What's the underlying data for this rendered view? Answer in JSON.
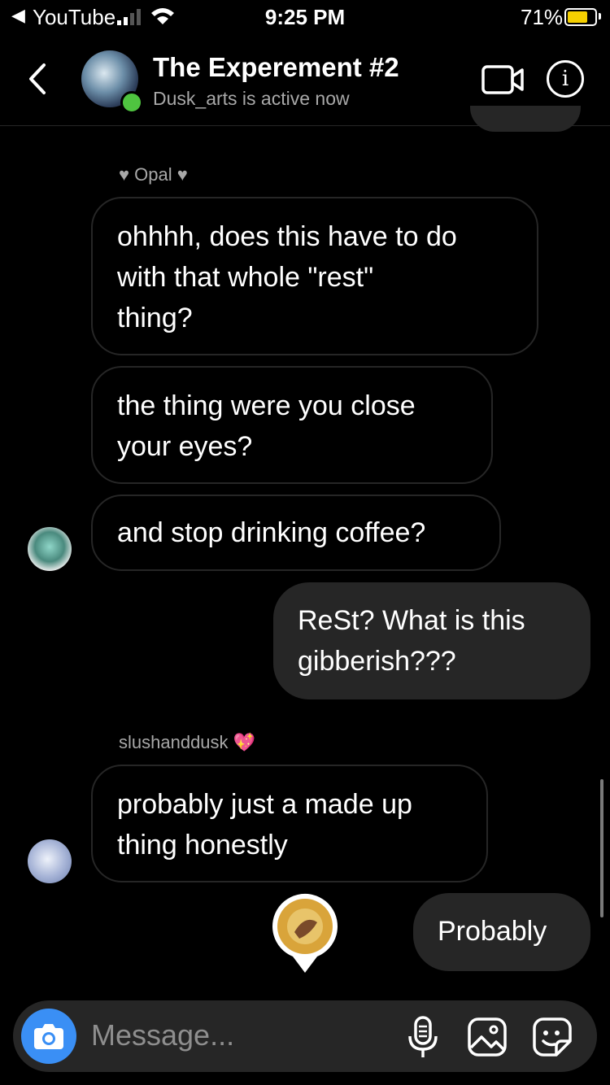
{
  "status_bar": {
    "back_app": "YouTube",
    "time": "9:25 PM",
    "battery_pct": "71%",
    "back_glyph": "◀"
  },
  "header": {
    "title": "The Experement #2",
    "subtitle": "Dusk_arts is active now",
    "info_glyph": "i"
  },
  "messages": {
    "opal_sender": "♥ Opal ♥",
    "m1": [
      "ohhhh, does this have to do",
      "with that whole \"rest\"",
      "thing?"
    ],
    "m2": [
      "the thing were you close",
      "your eyes?"
    ],
    "m3": "and stop drinking coffee?",
    "m4": [
      "ReSt? What is this",
      "gibberish???"
    ],
    "slush_sender": "slushanddusk",
    "slush_emoji": "💖",
    "m5": [
      "probably just a made up",
      "thing honestly"
    ],
    "m6": "Probably"
  },
  "composer": {
    "placeholder": "Message..."
  },
  "colors": {
    "online": "#4fc440",
    "camera": "#3a8ff5",
    "battery": "#f5d000",
    "outgoing_bubble": "#262626"
  },
  "icons": [
    "back-arrow-icon",
    "video-call-icon",
    "info-icon",
    "camera-icon",
    "microphone-icon",
    "gallery-icon",
    "sticker-icon"
  ]
}
